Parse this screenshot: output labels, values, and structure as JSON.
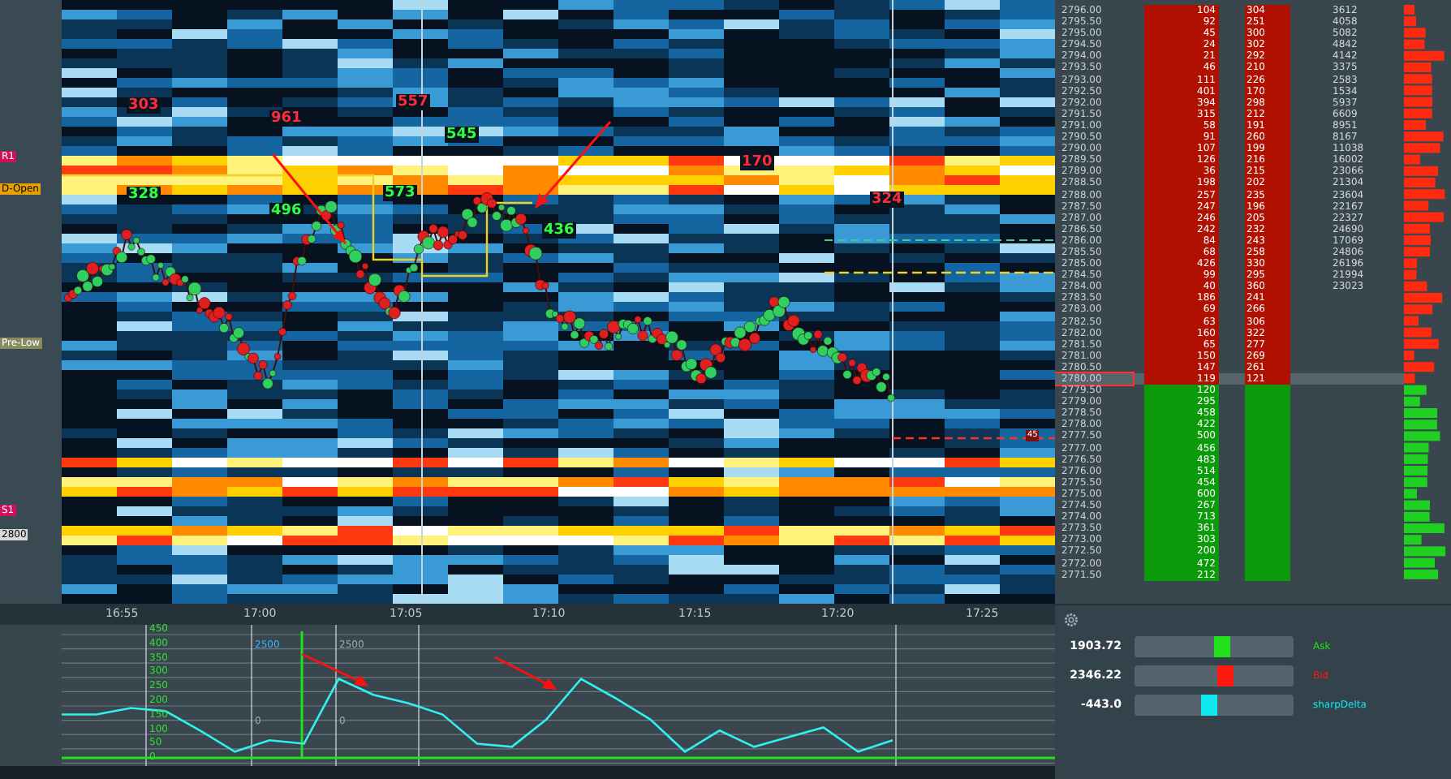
{
  "chart": {
    "level_labels": [
      {
        "text": "R1",
        "color": "#d0105a"
      },
      {
        "text": "D-Open",
        "color": "#e8a000"
      },
      {
        "text": "Pre-Low",
        "color": "#8a8a60"
      },
      {
        "text": "S1",
        "color": "#d0105a"
      },
      {
        "text": "2800",
        "color": "#d8d8d8"
      }
    ],
    "bubble_labels": [
      {
        "text": "303",
        "kind": "sell"
      },
      {
        "text": "328",
        "kind": "buy"
      },
      {
        "text": "961",
        "kind": "sell"
      },
      {
        "text": "496",
        "kind": "buy"
      },
      {
        "text": "557",
        "kind": "sell"
      },
      {
        "text": "573",
        "kind": "buy"
      },
      {
        "text": "545",
        "kind": "buy"
      },
      {
        "text": "436",
        "kind": "buy"
      },
      {
        "text": "170",
        "kind": "sell"
      },
      {
        "text": "324",
        "kind": "sell"
      }
    ],
    "last_trade": "45",
    "time_labels": [
      "16:55",
      "17:00",
      "17:05",
      "17:10",
      "17:15",
      "17:20",
      "17:25"
    ]
  },
  "indicator": {
    "notes": [
      "2500",
      "2500",
      "0",
      "0"
    ],
    "chart_data": {
      "type": "line",
      "grid": true,
      "ref_lines": [
        {
          "axis": "y",
          "value": 18,
          "color": "#20e020"
        }
      ],
      "ylim": [
        0,
        450
      ],
      "yticks": [
        {
          "value": 0,
          "label": "0"
        },
        {
          "value": 50,
          "label": "50"
        },
        {
          "value": 100,
          "label": "100"
        },
        {
          "value": 150,
          "label": "150"
        },
        {
          "value": 200,
          "label": "200"
        },
        {
          "value": 250,
          "label": "250"
        },
        {
          "value": 300,
          "label": "300"
        },
        {
          "value": 350,
          "label": "350"
        },
        {
          "value": 400,
          "label": "400"
        },
        {
          "value": 450,
          "label": "450"
        }
      ],
      "series": [
        {
          "color": "#30f0f0",
          "values": [
            170,
            170,
            193,
            182,
            114,
            40,
            80,
            68,
            295,
            239,
            210,
            170,
            68,
            57,
            153,
            295,
            227,
            153,
            40,
            114,
            57,
            91,
            125,
            40,
            80
          ]
        }
      ]
    }
  },
  "ladder": {
    "rows": [
      {
        "price": "2796.00",
        "kind": "ask",
        "c1": "104",
        "c2": "304",
        "c3": "3612"
      },
      {
        "price": "2795.50",
        "kind": "ask",
        "c1": "92",
        "c2": "251",
        "c3": "4058"
      },
      {
        "price": "2795.00",
        "kind": "ask",
        "c1": "45",
        "c2": "300",
        "c3": "5082"
      },
      {
        "price": "2794.50",
        "kind": "ask",
        "c1": "24",
        "c2": "302",
        "c3": "4842"
      },
      {
        "price": "2794.00",
        "kind": "ask",
        "c1": "21",
        "c2": "292",
        "c3": "4142"
      },
      {
        "price": "2793.50",
        "kind": "ask",
        "c1": "46",
        "c2": "210",
        "c3": "3375"
      },
      {
        "price": "2793.00",
        "kind": "ask",
        "c1": "111",
        "c2": "226",
        "c3": "2583"
      },
      {
        "price": "2792.50",
        "kind": "ask",
        "c1": "401",
        "c2": "170",
        "c3": "1534"
      },
      {
        "price": "2792.00",
        "kind": "ask",
        "c1": "394",
        "c2": "298",
        "c3": "5937"
      },
      {
        "price": "2791.50",
        "kind": "ask",
        "c1": "315",
        "c2": "212",
        "c3": "6609"
      },
      {
        "price": "2791.00",
        "kind": "ask",
        "c1": "58",
        "c2": "191",
        "c3": "8951"
      },
      {
        "price": "2790.50",
        "kind": "ask",
        "c1": "91",
        "c2": "260",
        "c3": "8167"
      },
      {
        "price": "2790.00",
        "kind": "ask",
        "c1": "107",
        "c2": "199",
        "c3": "11038"
      },
      {
        "price": "2789.50",
        "kind": "ask",
        "c1": "126",
        "c2": "216",
        "c3": "16002"
      },
      {
        "price": "2789.00",
        "kind": "ask",
        "c1": "36",
        "c2": "215",
        "c3": "23066"
      },
      {
        "price": "2788.50",
        "kind": "ask",
        "c1": "198",
        "c2": "202",
        "c3": "21304"
      },
      {
        "price": "2788.00",
        "kind": "ask",
        "c1": "257",
        "c2": "235",
        "c3": "23604"
      },
      {
        "price": "2787.50",
        "kind": "ask",
        "c1": "247",
        "c2": "196",
        "c3": "22167"
      },
      {
        "price": "2787.00",
        "kind": "ask",
        "c1": "246",
        "c2": "205",
        "c3": "22327"
      },
      {
        "price": "2786.50",
        "kind": "ask",
        "c1": "242",
        "c2": "232",
        "c3": "24690"
      },
      {
        "price": "2786.00",
        "kind": "ask",
        "c1": "84",
        "c2": "243",
        "c3": "17069"
      },
      {
        "price": "2785.50",
        "kind": "ask",
        "c1": "68",
        "c2": "258",
        "c3": "24806"
      },
      {
        "price": "2785.00",
        "kind": "ask",
        "c1": "426",
        "c2": "330",
        "c3": "26196"
      },
      {
        "price": "2784.50",
        "kind": "ask",
        "c1": "99",
        "c2": "295",
        "c3": "21994"
      },
      {
        "price": "2784.00",
        "kind": "ask",
        "c1": "40",
        "c2": "360",
        "c3": "23023"
      },
      {
        "price": "2783.50",
        "kind": "ask",
        "c1": "186",
        "c2": "241"
      },
      {
        "price": "2783.00",
        "kind": "ask",
        "c1": "69",
        "c2": "266"
      },
      {
        "price": "2782.50",
        "kind": "ask",
        "c1": "63",
        "c2": "306"
      },
      {
        "price": "2782.00",
        "kind": "ask",
        "c1": "160",
        "c2": "322"
      },
      {
        "price": "2781.50",
        "kind": "ask",
        "c1": "65",
        "c2": "277"
      },
      {
        "price": "2781.00",
        "kind": "ask",
        "c1": "150",
        "c2": "269"
      },
      {
        "price": "2780.50",
        "kind": "ask",
        "c1": "147",
        "c2": "261"
      },
      {
        "price": "2780.00",
        "kind": "last",
        "c1": "119",
        "c2": "121"
      },
      {
        "price": "2779.50",
        "kind": "bid",
        "c1": "120"
      },
      {
        "price": "2779.00",
        "kind": "bid",
        "c1": "295"
      },
      {
        "price": "2778.50",
        "kind": "bid",
        "c1": "458"
      },
      {
        "price": "2778.00",
        "kind": "bid",
        "c1": "422"
      },
      {
        "price": "2777.50",
        "kind": "bid",
        "c1": "500"
      },
      {
        "price": "2777.00",
        "kind": "bid",
        "c1": "456"
      },
      {
        "price": "2776.50",
        "kind": "bid",
        "c1": "483"
      },
      {
        "price": "2776.00",
        "kind": "bid",
        "c1": "514"
      },
      {
        "price": "2775.50",
        "kind": "bid",
        "c1": "454"
      },
      {
        "price": "2775.00",
        "kind": "bid",
        "c1": "600"
      },
      {
        "price": "2774.50",
        "kind": "bid",
        "c1": "267"
      },
      {
        "price": "2774.00",
        "kind": "bid",
        "c1": "713"
      },
      {
        "price": "2773.50",
        "kind": "bid",
        "c1": "361"
      },
      {
        "price": "2773.00",
        "kind": "bid",
        "c1": "303"
      },
      {
        "price": "2772.50",
        "kind": "bid",
        "c1": "200"
      },
      {
        "price": "2772.00",
        "kind": "bid",
        "c1": "472"
      },
      {
        "price": "2771.50",
        "kind": "bid",
        "c1": "212"
      }
    ]
  },
  "meters": [
    {
      "value": "1903.72",
      "label": "Ask",
      "level": 0.55,
      "color": "#22e01a"
    },
    {
      "value": "2346.22",
      "label": "Bid",
      "level": 0.57,
      "color": "#ff1a10"
    },
    {
      "value": "-443.0",
      "label": "sharpDelta",
      "level": 0.47,
      "color": "#10e8f0"
    }
  ]
}
